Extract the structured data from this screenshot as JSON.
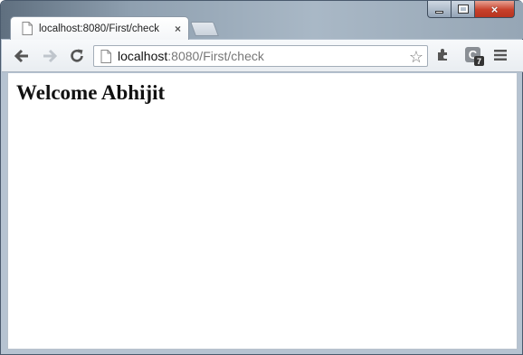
{
  "tab": {
    "title": "localhost:8080/First/check",
    "close": "×"
  },
  "window_controls": {
    "close": "×"
  },
  "address_bar": {
    "host": "localhost",
    "path": ":8080/First/check"
  },
  "icons": {
    "back": "back-arrow-icon",
    "forward": "forward-arrow-icon",
    "reload": "reload-icon",
    "star": "star-icon",
    "extension": "puzzle-extension-icon",
    "app_badge": "c-badge-icon",
    "menu": "hamburger-menu-icon"
  },
  "extension_badge": {
    "letter": "C",
    "count": "7"
  },
  "page": {
    "heading": "Welcome Abhijit"
  }
}
